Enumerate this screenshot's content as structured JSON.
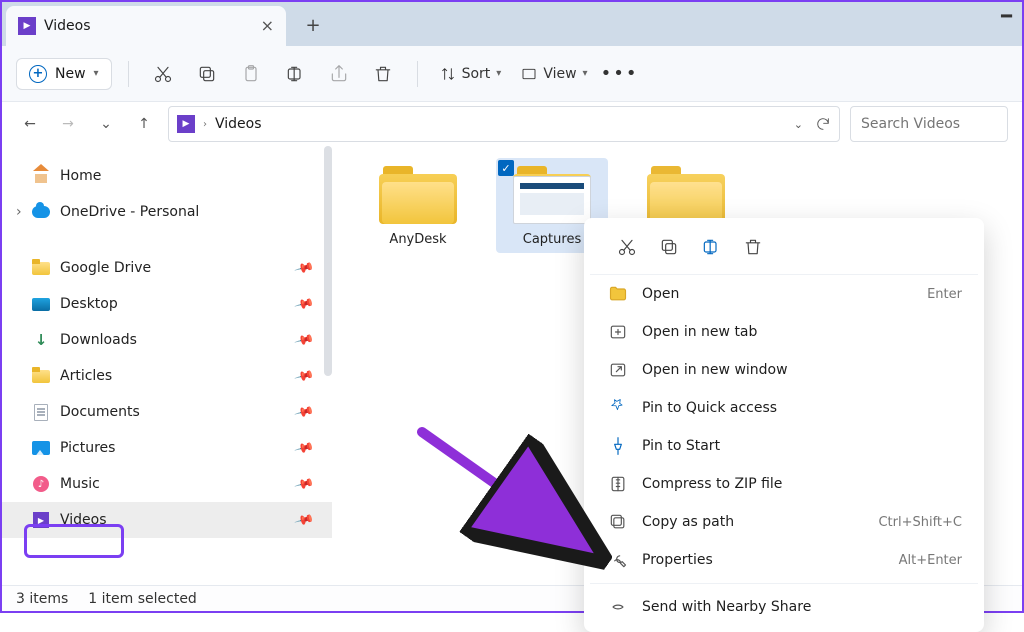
{
  "titlebar": {
    "tab_title": "Videos"
  },
  "toolbar": {
    "new_label": "New",
    "sort_label": "Sort",
    "view_label": "View"
  },
  "breadcrumb": {
    "current": "Videos"
  },
  "search": {
    "placeholder": "Search Videos"
  },
  "sidebar": {
    "home": "Home",
    "onedrive": "OneDrive - Personal",
    "items": [
      {
        "label": "Google Drive"
      },
      {
        "label": "Desktop"
      },
      {
        "label": "Downloads"
      },
      {
        "label": "Articles"
      },
      {
        "label": "Documents"
      },
      {
        "label": "Pictures"
      },
      {
        "label": "Music"
      },
      {
        "label": "Videos"
      }
    ]
  },
  "folders": [
    {
      "name": "AnyDesk",
      "selected": false
    },
    {
      "name": "Captures",
      "selected": true
    }
  ],
  "context_menu": {
    "items": [
      {
        "label": "Open",
        "shortcut": "Enter"
      },
      {
        "label": "Open in new tab",
        "shortcut": ""
      },
      {
        "label": "Open in new window",
        "shortcut": ""
      },
      {
        "label": "Pin to Quick access",
        "shortcut": ""
      },
      {
        "label": "Pin to Start",
        "shortcut": ""
      },
      {
        "label": "Compress to ZIP file",
        "shortcut": ""
      },
      {
        "label": "Copy as path",
        "shortcut": "Ctrl+Shift+C"
      },
      {
        "label": "Properties",
        "shortcut": "Alt+Enter"
      },
      {
        "label": "Send with Nearby Share",
        "shortcut": ""
      }
    ]
  },
  "status": {
    "count": "3 items",
    "selected": "1 item selected"
  }
}
